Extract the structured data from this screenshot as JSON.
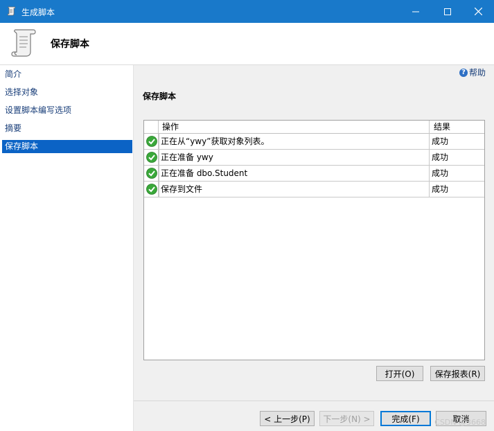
{
  "window": {
    "title": "生成脚本"
  },
  "header": {
    "title": "保存脚本"
  },
  "sidebar": {
    "items": [
      {
        "label": "简介"
      },
      {
        "label": "选择对象"
      },
      {
        "label": "设置脚本编写选项"
      },
      {
        "label": "摘要"
      },
      {
        "label": "保存脚本",
        "active": true
      }
    ]
  },
  "main": {
    "help_label": "帮助",
    "section_title": "保存脚本",
    "table": {
      "columns": [
        "操作",
        "结果"
      ],
      "rows": [
        {
          "operation": "正在从“ywy”获取对象列表。",
          "result": "成功",
          "status_icon": "success-check-icon"
        },
        {
          "operation": "正在准备 ywy",
          "result": "成功",
          "status_icon": "success-check-icon"
        },
        {
          "operation": "正在准备 dbo.Student",
          "result": "成功",
          "status_icon": "success-check-icon"
        },
        {
          "operation": "保存到文件",
          "result": "成功",
          "status_icon": "success-check-icon"
        }
      ]
    },
    "open_button": "打开(O)",
    "save_report_button": "保存报表(R)"
  },
  "footer": {
    "prev_button": "< 上一步(P)",
    "next_button": "下一步(N) >",
    "finish_button": "完成(F)",
    "cancel_button": "取消",
    "watermark": "CSDN @3668"
  },
  "colors": {
    "titlebar": "#1979ca",
    "selected": "#0b63c5",
    "success": "#3aa83a"
  }
}
